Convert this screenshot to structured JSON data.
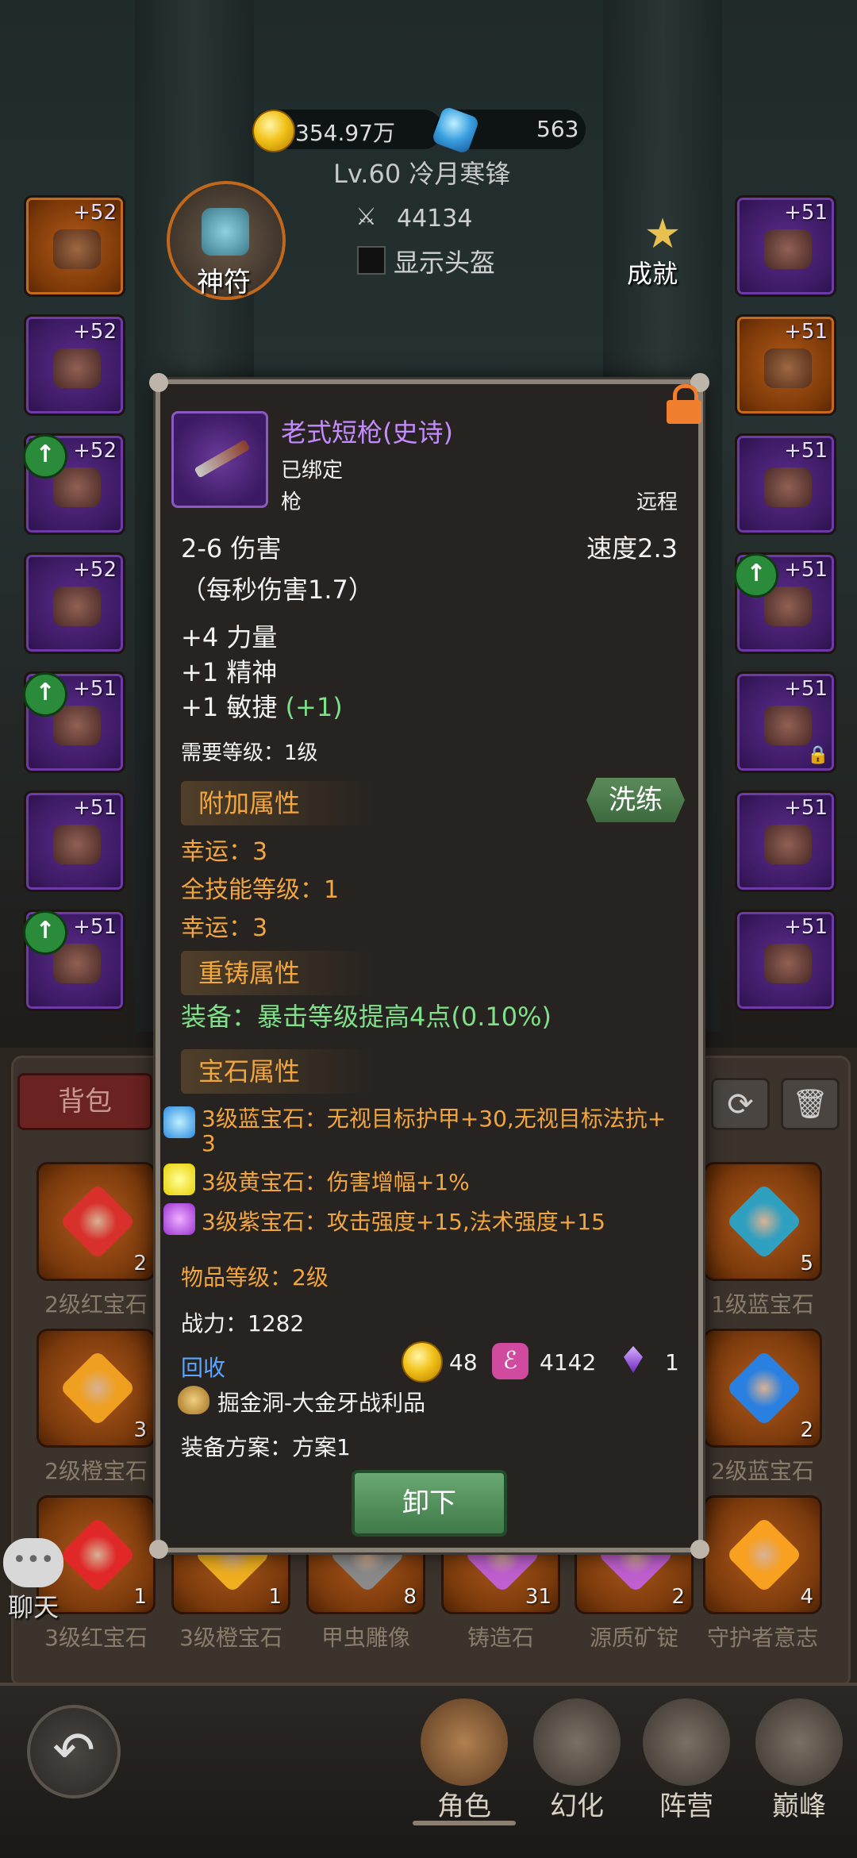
{
  "top": {
    "gold": "354.97万",
    "gems": "563",
    "player_title": "Lv.60 冷月寒锋",
    "power": "44134",
    "show_helmet_label": "显示头盔",
    "rune_label": "神符",
    "achievement_label": "成就"
  },
  "left_slots": [
    {
      "plus": "+52",
      "rarity": "orange",
      "upgrade": false
    },
    {
      "plus": "+52",
      "rarity": "purple",
      "upgrade": false
    },
    {
      "plus": "+52",
      "rarity": "purple",
      "upgrade": true
    },
    {
      "plus": "+52",
      "rarity": "purple",
      "upgrade": false
    },
    {
      "plus": "+51",
      "rarity": "purple",
      "upgrade": true
    },
    {
      "plus": "+51",
      "rarity": "purple",
      "upgrade": false
    },
    {
      "plus": "+51",
      "rarity": "purple",
      "upgrade": true
    }
  ],
  "right_slots": [
    {
      "plus": "+51",
      "rarity": "purple",
      "upgrade": false,
      "locked": false
    },
    {
      "plus": "+51",
      "rarity": "orange",
      "upgrade": false,
      "locked": false
    },
    {
      "plus": "+51",
      "rarity": "purple",
      "upgrade": false,
      "locked": false
    },
    {
      "plus": "+51",
      "rarity": "purple",
      "upgrade": true,
      "locked": false
    },
    {
      "plus": "+51",
      "rarity": "purple",
      "upgrade": false,
      "locked": true
    },
    {
      "plus": "+51",
      "rarity": "purple",
      "upgrade": false,
      "locked": false
    },
    {
      "plus": "+51",
      "rarity": "purple",
      "upgrade": false,
      "locked": false
    }
  ],
  "bag_tab": "背包",
  "inventory": [
    {
      "count": "2",
      "label": "2级红宝石",
      "color": "#d8302a"
    },
    {
      "count": "3",
      "label": "2级橙宝石",
      "color": "#f0a020"
    },
    {
      "count": "1",
      "label": "3级红宝石",
      "color": "#e02828"
    },
    {
      "count": "1",
      "label": "3级橙宝石",
      "color": "#f0b020"
    },
    {
      "count": "8",
      "label": "甲虫雕像",
      "color": "#8a8a8a"
    },
    {
      "count": "31",
      "label": "铸造石",
      "color": "#c060d0"
    },
    {
      "count": "2",
      "label": "源质矿锭",
      "color": "#c060d0"
    },
    {
      "count": "4",
      "label": "守护者意志",
      "color": "#f8a020"
    },
    {
      "count": "5",
      "label": "1级蓝宝石",
      "color": "#30a0c0"
    },
    {
      "count": "2",
      "label": "2级蓝宝石",
      "color": "#2a80e0"
    }
  ],
  "chat_label": "聊天",
  "item": {
    "name": "老式短枪(史诗)",
    "bound": "已绑定",
    "type": "枪",
    "range": "远程",
    "damage": "2-6 伤害",
    "speed": "速度2.3",
    "dps": "（每秒伤害1.7）",
    "stat1": "+4 力量",
    "stat2": "+1 精神",
    "stat3": "+1 敏捷",
    "stat3_bonus": "(+1)",
    "req_level": "需要等级：1级",
    "extra_header": "附加属性",
    "refine_button": "洗练",
    "extra1": "幸运：3",
    "extra2": "全技能等级：1",
    "extra3": "幸运：3",
    "recast_header": "重铸属性",
    "recast1": "装备：暴击等级提高4点(0.10%)",
    "gem_header": "宝石属性",
    "gem1_line1": "3级蓝宝石：无视目标护甲+30,无视目标法抗+",
    "gem1_line2": "3",
    "gem2": "3级黄宝石：伤害增幅+1%",
    "gem3": "3级紫宝石：攻击强度+15,法术强度+15",
    "item_level": "物品等级：2级",
    "combat_power": "战力：1282",
    "recycle_label": "回收",
    "recycle_gold": "48",
    "recycle_rune": "4142",
    "recycle_crystal": "1",
    "source": "掘金洞-大金牙战利品",
    "plan": "装备方案：方案1",
    "unequip_button": "卸下"
  },
  "nav": {
    "character": "角色",
    "transform": "幻化",
    "camp": "阵营",
    "peak": "巅峰"
  }
}
